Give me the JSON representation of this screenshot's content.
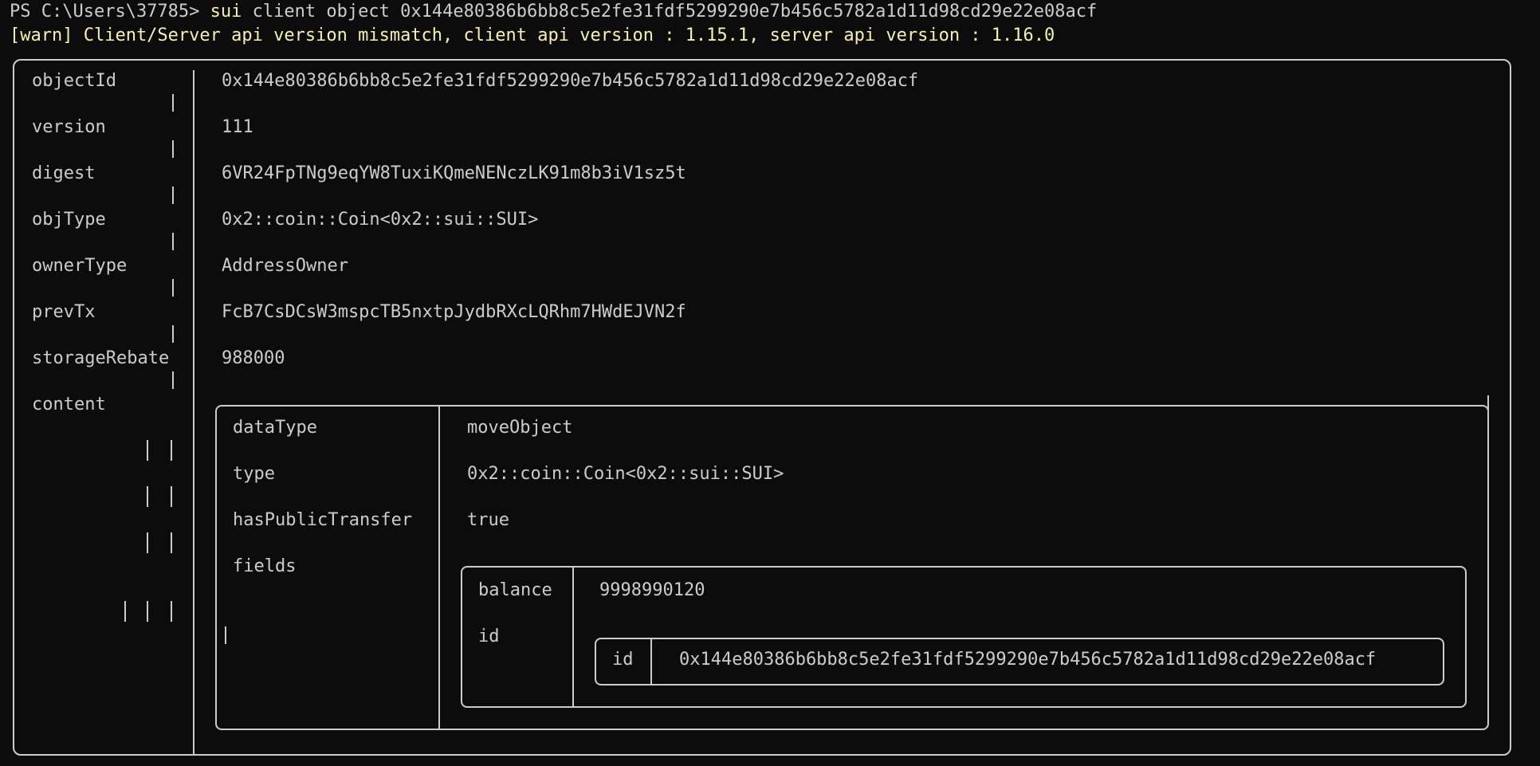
{
  "prompt": {
    "ps": "PS C:\\Users\\37785> ",
    "cmd": "sui",
    "args": " client object 0x144e80386b6bb8c5e2fe31fdf5299290e7b456c5782a1d11d98cd29e22e08acf"
  },
  "warning": "[warn] Client/Server api version mismatch, client api version : 1.15.1, server api version : 1.16.0",
  "rows": {
    "objectId": {
      "key": "objectId",
      "value": "0x144e80386b6bb8c5e2fe31fdf5299290e7b456c5782a1d11d98cd29e22e08acf"
    },
    "version": {
      "key": "version",
      "value": "111"
    },
    "digest": {
      "key": "digest",
      "value": "6VR24FpTNg9eqYW8TuxiKQmeNENczLK91m8b3iV1sz5t"
    },
    "objType": {
      "key": "objType",
      "value": "0x2::coin::Coin<0x2::sui::SUI>"
    },
    "ownerType": {
      "key": "ownerType",
      "value": "AddressOwner"
    },
    "prevTx": {
      "key": "prevTx",
      "value": "FcB7CsDCsW3mspcTB5nxtpJydbRXcLQRhm7HWdEJVN2f"
    },
    "storageRebate": {
      "key": "storageRebate",
      "value": "988000"
    },
    "content": {
      "key": "content"
    }
  },
  "content": {
    "dataType": {
      "key": "dataType",
      "value": "moveObject"
    },
    "type": {
      "key": "type",
      "value": "0x2::coin::Coin<0x2::sui::SUI>"
    },
    "hasPublicTransfer": {
      "key": "hasPublicTransfer",
      "value": "true"
    },
    "fields": {
      "key": "fields"
    }
  },
  "fields": {
    "balance": {
      "key": "balance",
      "value": "9998990120"
    },
    "id": {
      "key": "id"
    }
  },
  "idTable": {
    "key": "id",
    "value": "0x144e80386b6bb8c5e2fe31fdf5299290e7b456c5782a1d11d98cd29e22e08acf"
  }
}
